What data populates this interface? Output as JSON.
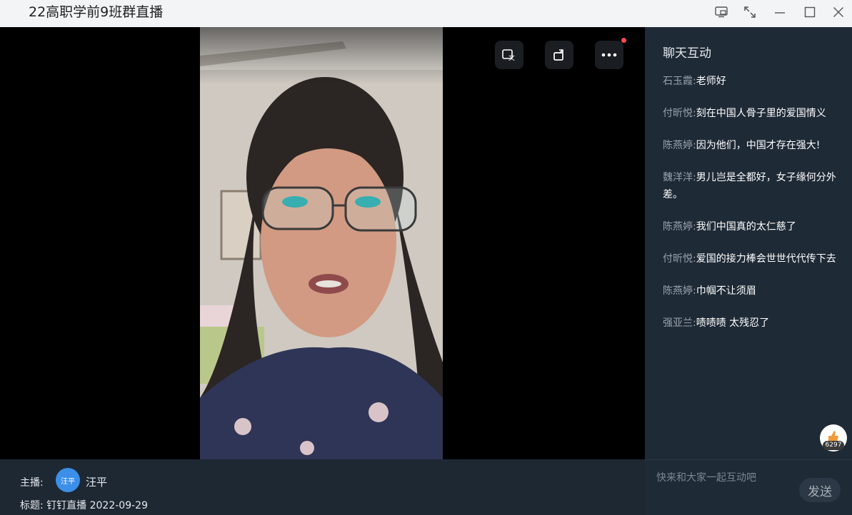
{
  "window": {
    "title": "22高职学前9班群直播"
  },
  "video": {
    "controls": [
      {
        "name": "subtitle-toggle-button",
        "icon": "subtitle-icon"
      },
      {
        "name": "rotate-button",
        "icon": "rotate-icon"
      },
      {
        "name": "more-button",
        "icon": "more-icon"
      }
    ]
  },
  "chat": {
    "title": "聊天互动",
    "messages": [
      {
        "sender": "石玉霞:",
        "text": "老师好"
      },
      {
        "sender": "付昕悦:",
        "text": "刻在中国人骨子里的爱国情义"
      },
      {
        "sender": "陈燕婷:",
        "text": "因为他们，中国才存在强大!"
      },
      {
        "sender": "魏洋洋:",
        "text": "男儿岂是全都好，女子缘何分外差。"
      },
      {
        "sender": "陈燕婷:",
        "text": "我们中国真的太仁慈了"
      },
      {
        "sender": "付昕悦:",
        "text": "爱国的接力棒会世世代代传下去"
      },
      {
        "sender": "陈燕婷:",
        "text": "巾帼不让须眉"
      },
      {
        "sender": "强亚兰:",
        "text": "啧啧啧 太残忍了"
      }
    ],
    "like_count": "6297",
    "input_placeholder": "快来和大家一起互动吧",
    "send_label": "发送"
  },
  "info": {
    "host_label": "主播:",
    "host_avatar_text": "汪平",
    "host_name": "汪平",
    "topic": "标题: 钉钉直播 2022-09-29"
  },
  "colors": {
    "accent": "#3b8fe8",
    "badge": "#ff4d4f"
  }
}
